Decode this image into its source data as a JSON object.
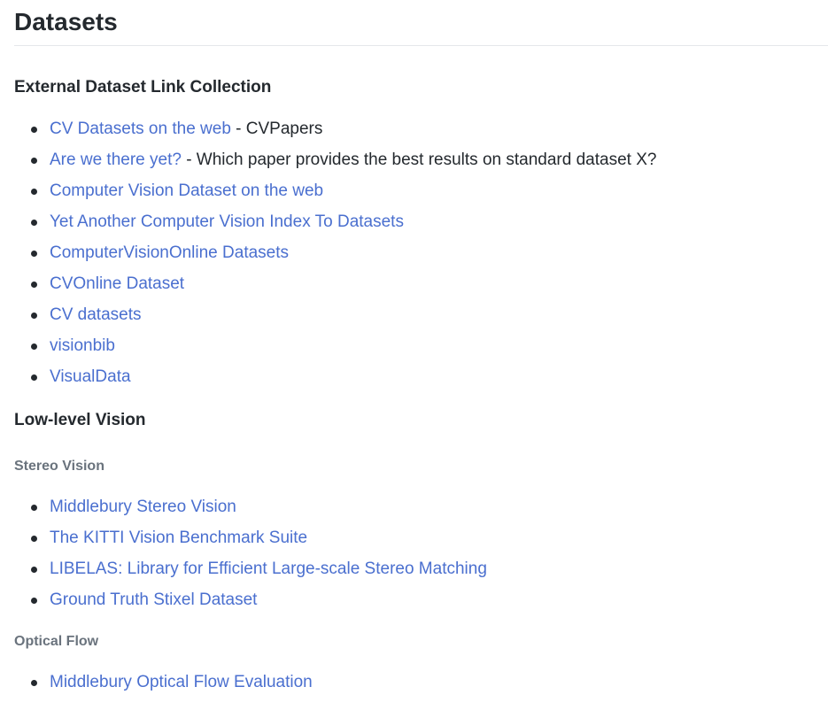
{
  "page_title": "Datasets",
  "sections": {
    "external": {
      "heading": "External Dataset Link Collection",
      "items": [
        {
          "link": "CV Datasets on the web",
          "suffix": " - CVPapers"
        },
        {
          "link": "Are we there yet?",
          "suffix": " - Which paper provides the best results on standard dataset X?"
        },
        {
          "link": "Computer Vision Dataset on the web",
          "suffix": ""
        },
        {
          "link": "Yet Another Computer Vision Index To Datasets",
          "suffix": ""
        },
        {
          "link": "ComputerVisionOnline Datasets",
          "suffix": ""
        },
        {
          "link": "CVOnline Dataset",
          "suffix": ""
        },
        {
          "link": "CV datasets",
          "suffix": ""
        },
        {
          "link": "visionbib",
          "suffix": ""
        },
        {
          "link": "VisualData",
          "suffix": ""
        }
      ]
    },
    "low_level": {
      "heading": "Low-level Vision"
    },
    "stereo": {
      "heading": "Stereo Vision",
      "items": [
        {
          "link": "Middlebury Stereo Vision"
        },
        {
          "link": "The KITTI Vision Benchmark Suite"
        },
        {
          "link": "LIBELAS: Library for Efficient Large-scale Stereo Matching"
        },
        {
          "link": "Ground Truth Stixel Dataset"
        }
      ]
    },
    "optical_flow": {
      "heading": "Optical Flow",
      "items": [
        {
          "link": "Middlebury Optical Flow Evaluation"
        }
      ]
    }
  },
  "colors": {
    "link": "#4a6fcf",
    "text": "#24292e",
    "subheading": "#6a737d"
  }
}
